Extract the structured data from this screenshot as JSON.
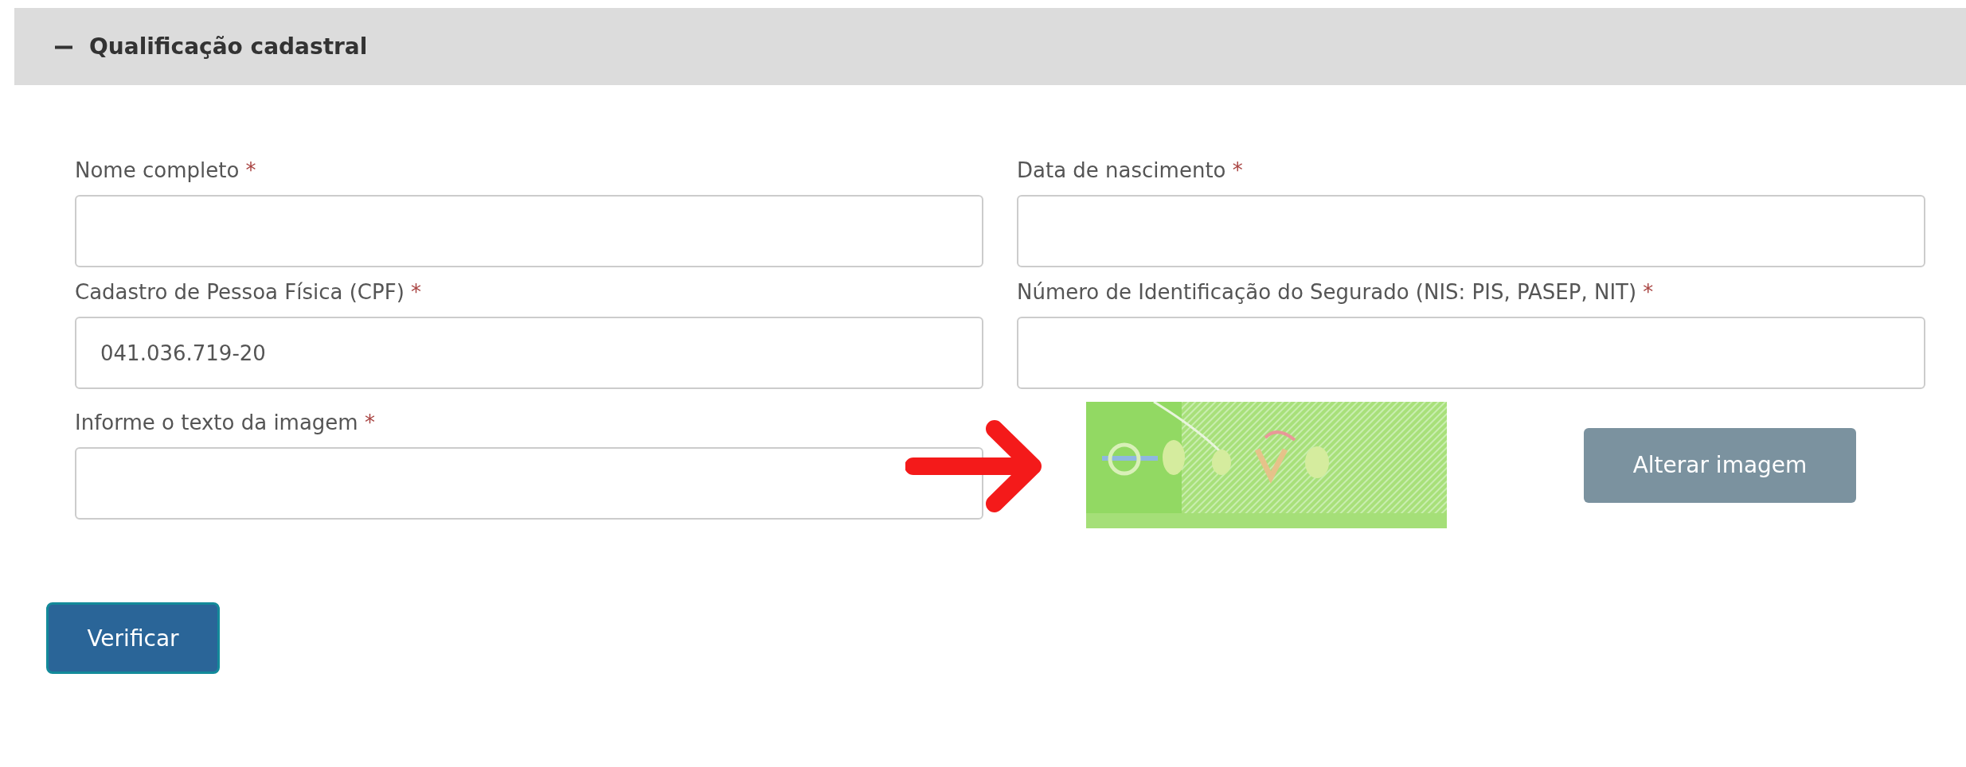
{
  "section": {
    "title": "Qualificação cadastral",
    "expanded": true
  },
  "fields": [
    {
      "label": "Nome completo",
      "mark": "*"
    },
    {
      "label": "Data de nascimento",
      "mark": "*"
    },
    {
      "label": "Cadastro de Pessoa Física (CPF)",
      "mark": "*",
      "value": "041.036.719-20"
    },
    {
      "label": "Número de Identificação do Segurado (NIS: PIS, PASEP, NIT)",
      "mark": "*"
    }
  ],
  "captcha": {
    "label": "Informe o texto da imagem",
    "mark": "*",
    "refresh_button": "Alterar imagem"
  },
  "submit_button": "Verificar"
}
